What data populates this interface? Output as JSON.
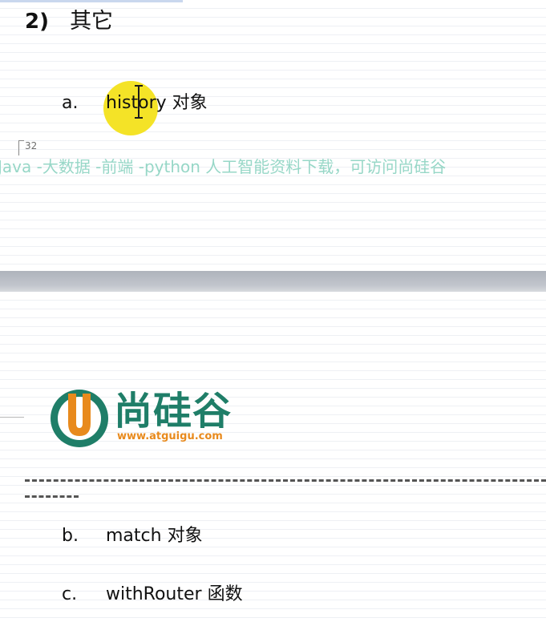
{
  "heading": {
    "number": "2)",
    "text": "其它"
  },
  "items": [
    {
      "marker": "a.",
      "text": "history 对象"
    },
    {
      "marker": "b.",
      "text": "match 对象"
    },
    {
      "marker": "c.",
      "text": "withRouter 函数"
    }
  ],
  "page_number": "32",
  "watermark": "Java -大数据 -前端 -python 人工智能资料下载，可访问尚硅谷",
  "logo": {
    "brand_text": "尚硅谷",
    "url": "www.atguigu.com",
    "colors": {
      "green": "#1f7e68",
      "orange": "#e88a1d"
    }
  }
}
